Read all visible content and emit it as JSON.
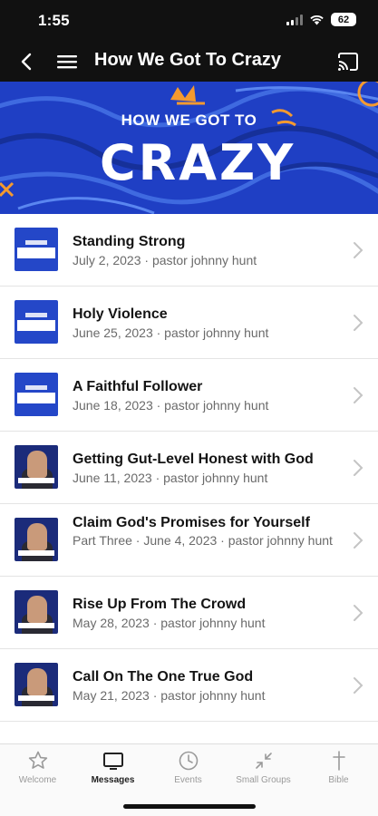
{
  "status_bar": {
    "time": "1:55",
    "battery": "62"
  },
  "nav": {
    "title": "How We Got To Crazy"
  },
  "banner": {
    "line1": "HOW WE GOT TO",
    "line2": "CRAZY"
  },
  "sermons": [
    {
      "title": "Standing Strong",
      "subtitle": "July 2, 2023 · pastor johnny hunt",
      "thumb": "series"
    },
    {
      "title": "Holy Violence",
      "subtitle": "June 25, 2023 · pastor johnny hunt",
      "thumb": "series"
    },
    {
      "title": "A Faithful Follower",
      "subtitle": "June 18, 2023 · pastor johnny hunt",
      "thumb": "series"
    },
    {
      "title": "Getting Gut-Level Honest with God",
      "subtitle": "June 11, 2023 · pastor johnny hunt",
      "thumb": "photo"
    },
    {
      "title": "Claim God's Promises for Yourself",
      "subtitle": "Part Three · June 4, 2023 · pastor johnny hunt",
      "thumb": "photo"
    },
    {
      "title": "Rise Up From The Crowd",
      "subtitle": "May 28, 2023 · pastor johnny hunt",
      "thumb": "photo"
    },
    {
      "title": "Call On The One True God",
      "subtitle": "May 21, 2023 · pastor johnny hunt",
      "thumb": "photo"
    }
  ],
  "tabs": [
    {
      "label": "Welcome",
      "icon": "star-icon"
    },
    {
      "label": "Messages",
      "icon": "tv-icon",
      "active": true
    },
    {
      "label": "Events",
      "icon": "clock-icon"
    },
    {
      "label": "Small Groups",
      "icon": "arrows-in-icon"
    },
    {
      "label": "Bible",
      "icon": "cross-icon"
    }
  ],
  "colors": {
    "bar": "#111111",
    "banner": "#1f3fc4",
    "accent": "#f59a2f"
  }
}
